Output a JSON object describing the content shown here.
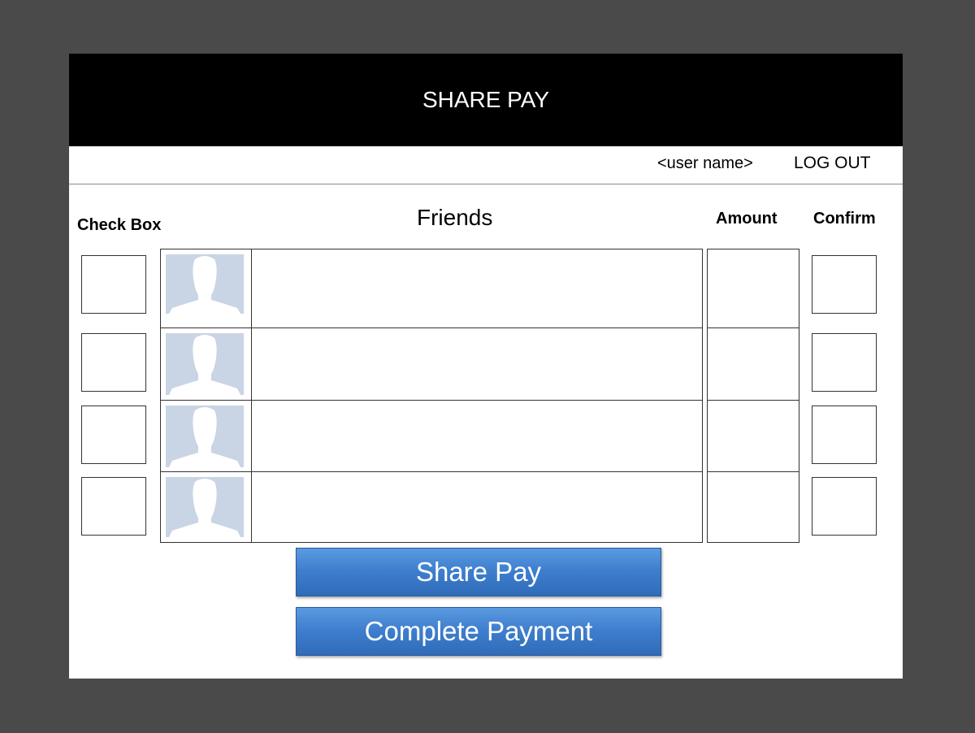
{
  "app": {
    "title": "SHARE PAY"
  },
  "header": {
    "user_name": "<user name>",
    "logout_label": "LOG OUT"
  },
  "columns": {
    "check_box": "Check Box",
    "friends": "Friends",
    "amount": "Amount",
    "confirm": "Confirm"
  },
  "rows": [
    {
      "friend_name": "",
      "amount": ""
    },
    {
      "friend_name": "",
      "amount": ""
    },
    {
      "friend_name": "",
      "amount": ""
    },
    {
      "friend_name": "",
      "amount": ""
    }
  ],
  "buttons": {
    "share_pay": "Share Pay",
    "complete_payment": "Complete Payment"
  },
  "icons": {
    "avatar": "default-profile-silhouette-icon"
  },
  "colors": {
    "background": "#4a4a4a",
    "titlebar": "#000000",
    "button": "#3f7fcf",
    "avatar_bg": "#c9d4e5"
  }
}
